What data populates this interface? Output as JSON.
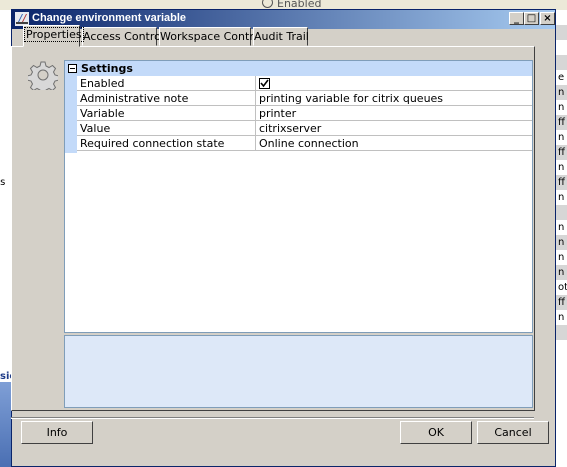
{
  "background": {
    "top_text": "Enabled",
    "left_text_1": "es",
    "left_text_2": "sic",
    "right_fragments": [
      "",
      "",
      "",
      "",
      "e",
      "n",
      "n",
      "ff",
      "n",
      "ff",
      "n",
      "ff",
      "n",
      "",
      "n",
      "n",
      "n",
      "n",
      "ot",
      "ff",
      "n",
      ""
    ]
  },
  "window": {
    "title": "Change environment variable",
    "minimize_label": "_",
    "maximize_label": "□",
    "close_label": "×"
  },
  "tabs": [
    {
      "label": "Properties",
      "active": true
    },
    {
      "label": "Access Control",
      "active": false
    },
    {
      "label": "Workspace Control",
      "active": false
    },
    {
      "label": "Audit Trail",
      "active": false
    }
  ],
  "settings": {
    "header": "Settings",
    "rows": [
      {
        "key": "Enabled",
        "value": "",
        "checked": true
      },
      {
        "key": "Administrative note",
        "value": "printing variable for citrix queues"
      },
      {
        "key": "Variable",
        "value": "printer"
      },
      {
        "key": "Value",
        "value": "citrixserver"
      },
      {
        "key": "Required connection state",
        "value": "Online connection"
      }
    ]
  },
  "buttons": {
    "info": "Info",
    "ok": "OK",
    "cancel": "Cancel"
  },
  "icons": {
    "title": "environment-variable-icon",
    "panel": "gear-icon",
    "checkbox": "checkmark-icon"
  }
}
